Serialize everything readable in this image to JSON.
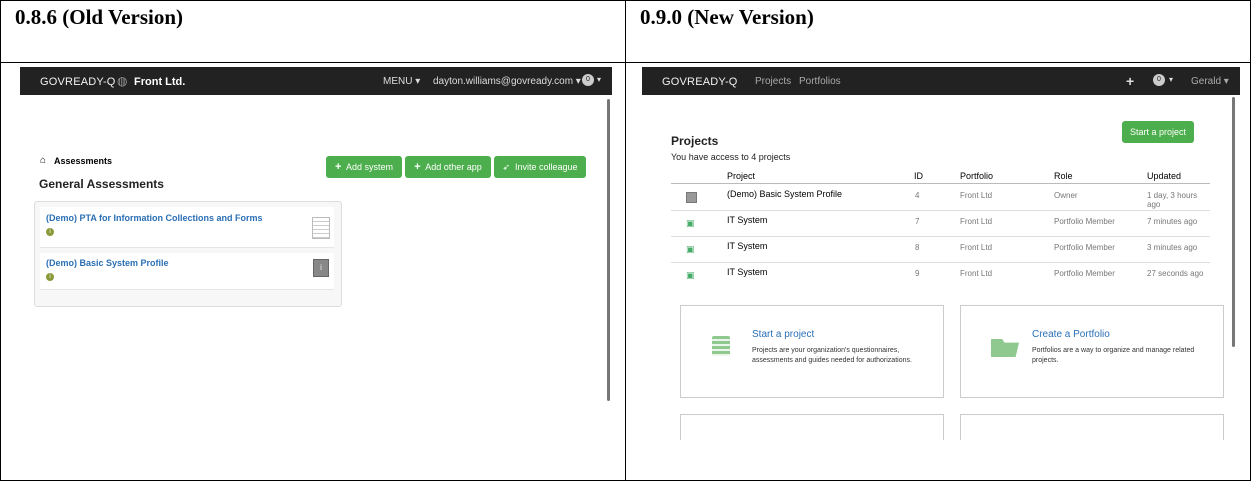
{
  "left": {
    "heading": "0.8.6 (Old Version)",
    "navbar": {
      "logo": "GOVREADY-Q",
      "org": "Front Ltd.",
      "menu": "MENU ▾",
      "user": "dayton.williams@govready.com ▾",
      "badge": "0"
    },
    "breadcrumb": "Assessments",
    "title": "General Assessments",
    "buttons": {
      "add_system": "Add system",
      "add_other_app": "Add other app",
      "invite": "Invite colleague"
    },
    "items": [
      {
        "label": "(Demo) PTA for Information Collections and Forms"
      },
      {
        "label": "(Demo) Basic System Profile"
      }
    ]
  },
  "right": {
    "heading": "0.9.0 (New Version)",
    "navbar": {
      "logo": "GOVREADY-Q",
      "projects": "Projects",
      "portfolios": "Portfolios",
      "plus": "+",
      "badge": "0",
      "user": "Gerald ▾"
    },
    "title": "Projects",
    "subtitle": "You have access to 4 projects",
    "start_button": "Start a project",
    "table": {
      "headers": [
        "Project",
        "ID",
        "Portfolio",
        "Role",
        "Updated"
      ],
      "rows": [
        {
          "project": "(Demo) Basic System Profile",
          "id": "4",
          "portfolio": "Front Ltd",
          "role": "Owner",
          "updated": "1 day, 3 hours ago"
        },
        {
          "project": "IT System",
          "id": "7",
          "portfolio": "Front Ltd",
          "role": "Portfolio Member",
          "updated": "7 minutes ago"
        },
        {
          "project": "IT System",
          "id": "8",
          "portfolio": "Front Ltd",
          "role": "Portfolio Member",
          "updated": "3 minutes ago"
        },
        {
          "project": "IT System",
          "id": "9",
          "portfolio": "Front Ltd",
          "role": "Portfolio Member",
          "updated": "27 seconds ago"
        }
      ]
    },
    "cards": [
      {
        "title": "Start a project",
        "text": "Projects are your organization's questionnaires, assessments and guides needed for authorizations."
      },
      {
        "title": "Create a Portfolio",
        "text": "Portfolios are a way to organize and manage related projects."
      }
    ]
  },
  "colors": {
    "navbar": "#222222",
    "green": "#4cae4c",
    "link": "#2a6fb5"
  }
}
